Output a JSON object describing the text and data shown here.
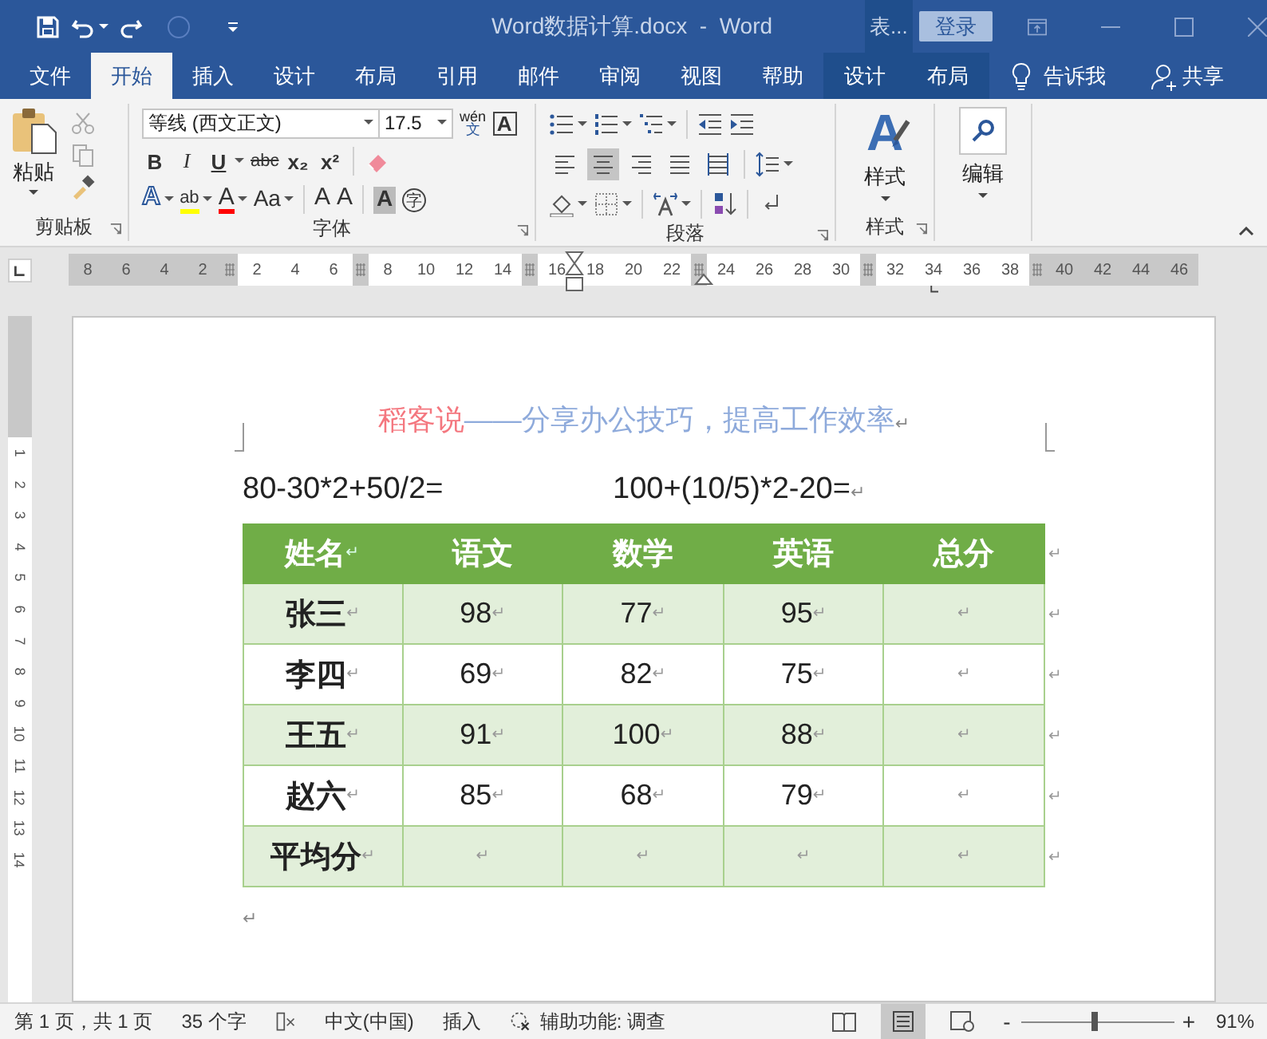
{
  "title_bar": {
    "title": "Word数据计算.docx  -  Word",
    "context_tab": "表...",
    "login_button": "登录"
  },
  "tabs": [
    {
      "label": "文件",
      "selected": false,
      "kind": "normal"
    },
    {
      "label": "开始",
      "selected": true,
      "kind": "normal"
    },
    {
      "label": "插入",
      "selected": false,
      "kind": "normal"
    },
    {
      "label": "设计",
      "selected": false,
      "kind": "normal"
    },
    {
      "label": "布局",
      "selected": false,
      "kind": "normal"
    },
    {
      "label": "引用",
      "selected": false,
      "kind": "normal"
    },
    {
      "label": "邮件",
      "selected": false,
      "kind": "normal"
    },
    {
      "label": "审阅",
      "selected": false,
      "kind": "normal"
    },
    {
      "label": "视图",
      "selected": false,
      "kind": "normal"
    },
    {
      "label": "帮助",
      "selected": false,
      "kind": "normal"
    },
    {
      "label": "设计",
      "selected": false,
      "kind": "context"
    },
    {
      "label": "布局",
      "selected": false,
      "kind": "context"
    }
  ],
  "tell_me": "告诉我",
  "share": "共享",
  "ribbon": {
    "clipboard": {
      "paste": "粘贴",
      "group_label": "剪贴板"
    },
    "font": {
      "font_name": "等线 (西文正文)",
      "font_size": "17.5",
      "phonetic_top": "wén",
      "phonetic_bottom": "文",
      "border_char": "A",
      "format_buttons": [
        {
          "text": "B",
          "kind": "bold"
        },
        {
          "text": "I",
          "kind": "italic"
        },
        {
          "text": "U",
          "kind": "underline"
        },
        {
          "text": "abc",
          "kind": "strike"
        },
        {
          "text": "x₂",
          "kind": "sub"
        },
        {
          "text": "x²",
          "kind": "sup"
        }
      ],
      "effect_buttons": [
        {
          "text": "A",
          "kind": "effects"
        },
        {
          "text": "ab",
          "kind": "highlight",
          "color": "#ffff00"
        },
        {
          "text": "A",
          "kind": "fontcolor",
          "color": "#ff0000"
        },
        {
          "text": "Aa",
          "kind": "case"
        },
        {
          "text": "A",
          "kind": "grow"
        },
        {
          "text": "A",
          "kind": "shrink"
        },
        {
          "text": "A",
          "kind": "shading"
        },
        {
          "text": "字",
          "kind": "enclose"
        }
      ],
      "group_label": "字体"
    },
    "paragraph": {
      "align": [
        {
          "kind": "left",
          "selected": false
        },
        {
          "kind": "center",
          "selected": true
        },
        {
          "kind": "right",
          "selected": false
        },
        {
          "kind": "justify",
          "selected": false
        },
        {
          "kind": "distributed",
          "selected": false
        }
      ],
      "group_label": "段落"
    },
    "styles": {
      "icon_letter": "A",
      "label": "样式",
      "group_label": "样式"
    },
    "editing": {
      "label": "编辑"
    }
  },
  "ruler": {
    "ticks": [
      {
        "kind": "label",
        "label": "8",
        "margin": true
      },
      {
        "kind": "label",
        "label": "6",
        "margin": true
      },
      {
        "kind": "label",
        "label": "4",
        "margin": true
      },
      {
        "kind": "label",
        "label": "2",
        "margin": true
      },
      {
        "kind": "marker"
      },
      {
        "kind": "label",
        "label": "2",
        "margin": false
      },
      {
        "kind": "label",
        "label": "4",
        "margin": false
      },
      {
        "kind": "label",
        "label": "6",
        "margin": false
      },
      {
        "kind": "marker"
      },
      {
        "kind": "label",
        "label": "8",
        "margin": false
      },
      {
        "kind": "label",
        "label": "10",
        "margin": false
      },
      {
        "kind": "label",
        "label": "12",
        "margin": false
      },
      {
        "kind": "label",
        "label": "14",
        "margin": false
      },
      {
        "kind": "marker"
      },
      {
        "kind": "label",
        "label": "16",
        "margin": false
      },
      {
        "kind": "label",
        "label": "18",
        "margin": false
      },
      {
        "kind": "label",
        "label": "20",
        "margin": false
      },
      {
        "kind": "label",
        "label": "22",
        "margin": false
      },
      {
        "kind": "marker"
      },
      {
        "kind": "label",
        "label": "24",
        "margin": false
      },
      {
        "kind": "label",
        "label": "26",
        "margin": false
      },
      {
        "kind": "label",
        "label": "28",
        "margin": false
      },
      {
        "kind": "label",
        "label": "30",
        "margin": false
      },
      {
        "kind": "marker"
      },
      {
        "kind": "label",
        "label": "32",
        "margin": false
      },
      {
        "kind": "label",
        "label": "34",
        "margin": false
      },
      {
        "kind": "label",
        "label": "36",
        "margin": false
      },
      {
        "kind": "label",
        "label": "38",
        "margin": false
      },
      {
        "kind": "marker"
      },
      {
        "kind": "label",
        "label": "40",
        "margin": true
      },
      {
        "kind": "label",
        "label": "42",
        "margin": true
      },
      {
        "kind": "label",
        "label": "44",
        "margin": true
      },
      {
        "kind": "label",
        "label": "46",
        "margin": true
      }
    ]
  },
  "vertical_ruler": {
    "labels": [
      "1",
      "2",
      "3",
      "4",
      "5",
      "6",
      "7",
      "8",
      "9",
      "10",
      "11",
      "12",
      "13",
      "14"
    ]
  },
  "document": {
    "heading_brand": "稻客说",
    "heading_slogan": "——分享办公技巧，提高工作效率",
    "heading_mark": "↵",
    "formula_1": "80-30*2+50/2=",
    "formula_2": "100+(10/5)*2-20=",
    "formula_mark": "↵",
    "table": {
      "columns": [
        {
          "text": "姓名",
          "mark": "↵"
        },
        {
          "text": "语文"
        },
        {
          "text": "数学"
        },
        {
          "text": "英语"
        },
        {
          "text": "总分"
        }
      ],
      "header_end_mark": "↵",
      "rows": [
        {
          "shaded": true,
          "cells": [
            {
              "text": "张三",
              "mark": "↵"
            },
            {
              "text": "98",
              "mark": "↵"
            },
            {
              "text": "77",
              "mark": "↵"
            },
            {
              "text": "95",
              "mark": "↵"
            },
            {
              "mark": "↵"
            }
          ],
          "end_mark": "↵"
        },
        {
          "shaded": false,
          "cells": [
            {
              "text": "李四",
              "mark": "↵"
            },
            {
              "text": "69",
              "mark": "↵"
            },
            {
              "text": "82",
              "mark": "↵"
            },
            {
              "text": "75",
              "mark": "↵"
            },
            {
              "mark": "↵"
            }
          ],
          "end_mark": "↵"
        },
        {
          "shaded": true,
          "cells": [
            {
              "text": "王五",
              "mark": "↵"
            },
            {
              "text": "91",
              "mark": "↵"
            },
            {
              "text": "100",
              "mark": "↵"
            },
            {
              "text": "88",
              "mark": "↵"
            },
            {
              "mark": "↵"
            }
          ],
          "end_mark": "↵"
        },
        {
          "shaded": false,
          "cells": [
            {
              "text": "赵六",
              "mark": "↵"
            },
            {
              "text": "85",
              "mark": "↵"
            },
            {
              "text": "68",
              "mark": "↵"
            },
            {
              "text": "79",
              "mark": "↵"
            },
            {
              "mark": "↵"
            }
          ],
          "end_mark": "↵"
        },
        {
          "shaded": true,
          "cells": [
            {
              "text": "平均分",
              "mark": "↵"
            },
            {
              "mark": "↵"
            },
            {
              "mark": "↵"
            },
            {
              "mark": "↵"
            },
            {
              "mark": "↵"
            }
          ],
          "end_mark": "↵"
        }
      ]
    },
    "after_table_mark": "↵"
  },
  "status_bar": {
    "page": "第 1 页，共 1 页",
    "words": "35 个字",
    "language": "中文(中国)",
    "mode": "插入",
    "accessibility": "辅助功能: 调查",
    "views": [
      {
        "kind": "read",
        "selected": false
      },
      {
        "kind": "print",
        "selected": true
      },
      {
        "kind": "web",
        "selected": false
      }
    ],
    "zoom_minus": "-",
    "zoom_plus": "+",
    "zoom": {
      "level": 0.48
    },
    "zoom_reading": "91%"
  }
}
